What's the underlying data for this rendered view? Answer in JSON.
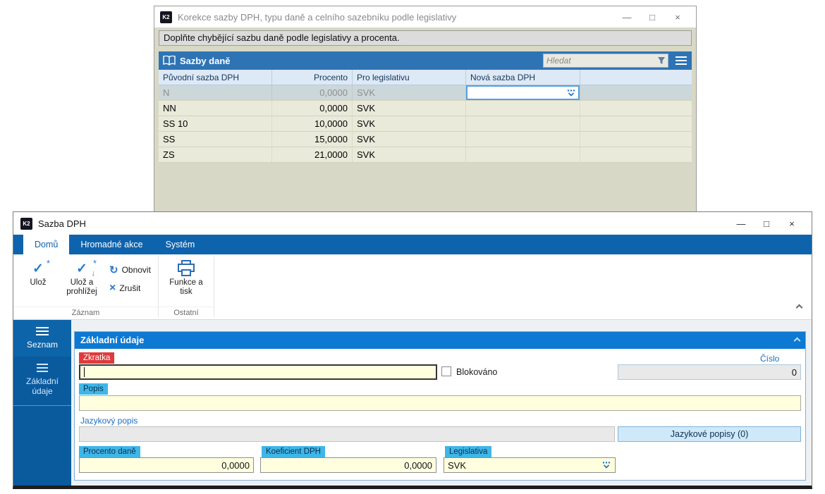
{
  "app_logo": "K2",
  "colors": {
    "k2_blue": "#0e63ad",
    "panel_header_blue": "#0d79d2",
    "table_header_blue": "#2e74b5",
    "sidebar_blue": "#0a5a9e",
    "accent_blue": "#2a7ad0",
    "required_red": "#e03a3a",
    "label_cyan": "#3fb6e8",
    "field_yellow": "#ffffdf",
    "window_beige": "#d8d8c6",
    "row_beige": "#eaeadb",
    "selected_row": "#ccd7da"
  },
  "back_window": {
    "title": "Korekce sazby DPH, typu daně a celního sazebníku podle legislativy",
    "controls": {
      "minimize": "—",
      "maximize": "□",
      "close": "×"
    },
    "message": "Doplňte chybějící sazbu daně podle legislativy a procenta.",
    "panel_title": "Sazby daně",
    "search_placeholder": "Hledat",
    "table": {
      "columns": [
        "Původní sazba DPH",
        "Procento",
        "Pro legislativu",
        "Nová sazba DPH"
      ],
      "rows": [
        {
          "sazba": "N",
          "procento": "0,0000",
          "legislativa": "SVK",
          "nova_sazba": ""
        },
        {
          "sazba": "NN",
          "procento": "0,0000",
          "legislativa": "SVK",
          "nova_sazba": ""
        },
        {
          "sazba": "SS 10",
          "procento": "10,0000",
          "legislativa": "SVK",
          "nova_sazba": ""
        },
        {
          "sazba": "SS",
          "procento": "15,0000",
          "legislativa": "SVK",
          "nova_sazba": ""
        },
        {
          "sazba": "ZS",
          "procento": "21,0000",
          "legislativa": "SVK",
          "nova_sazba": ""
        }
      ]
    }
  },
  "front_window": {
    "title": "Sazba DPH",
    "controls": {
      "minimize": "—",
      "maximize": "□",
      "close": "×"
    },
    "tabs": [
      {
        "label": "Domů"
      },
      {
        "label": "Hromadné akce"
      },
      {
        "label": "Systém"
      }
    ],
    "ribbon": {
      "save": "Ulož",
      "save_and_view": "Ulož a prohlížej",
      "refresh": "Obnovit",
      "cancel": "Zrušit",
      "functions_print": "Funkce a tisk",
      "group_record": "Záznam",
      "group_other": "Ostatní",
      "icons": {
        "check": "✓",
        "star": "*",
        "arrow_down": "↓",
        "refresh": "↻",
        "cancel": "×"
      }
    },
    "sidebar": {
      "seznam": "Seznam",
      "zakladni_udaje": "Základní údaje"
    },
    "form": {
      "section_title": "Základní údaje",
      "zkratka_label": "Zkratka",
      "zkratka_value": "",
      "blokovano_label": "Blokováno",
      "cislo_label": "Číslo",
      "cislo_value": "0",
      "popis_label": "Popis",
      "popis_value": "",
      "jazykovy_popis_label": "Jazykový popis",
      "jazykovy_popis_value": "",
      "jazykove_popisy_button": "Jazykové popisy (0)",
      "procento_dane_label": "Procento daně",
      "procento_dane_value": "0,0000",
      "koeficient_dph_label": "Koeficient DPH",
      "koeficient_dph_value": "0,0000",
      "legislativa_label": "Legislativa",
      "legislativa_value": "SVK"
    }
  }
}
